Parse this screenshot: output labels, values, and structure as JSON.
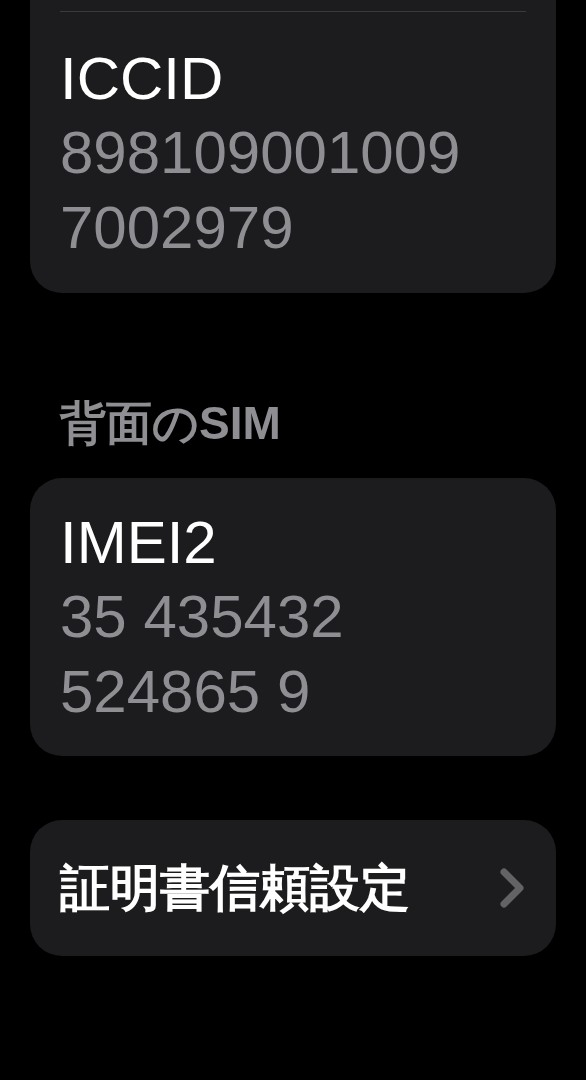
{
  "top_card": {
    "label": "ICCID",
    "value_lines": [
      "898109001009",
      "7002979"
    ]
  },
  "section_header": "背面のSIM",
  "imei_card": {
    "label": "IMEI2",
    "value_lines": [
      "35 435432",
      "524865 9"
    ]
  },
  "link_row": {
    "label": "証明書信頼設定"
  }
}
